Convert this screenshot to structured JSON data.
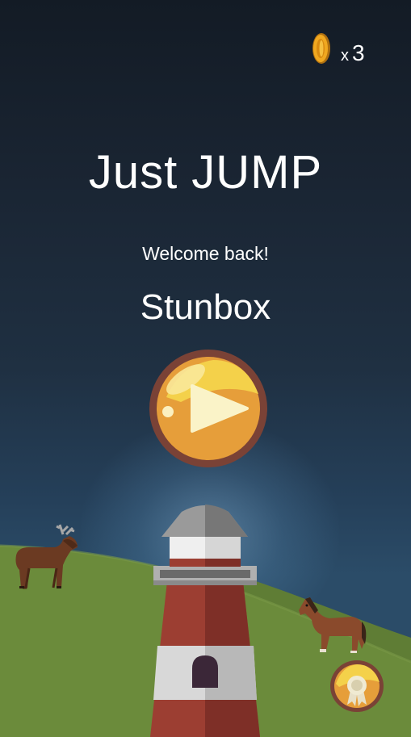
{
  "hud": {
    "coin_prefix": "x",
    "coin_count": "3",
    "coin_icon": "coin-icon"
  },
  "menu": {
    "title": "Just JUMP",
    "welcome": "Welcome back!",
    "username": "Stunbox",
    "play_icon": "play-icon",
    "achievements_icon": "award-ribbon-icon"
  },
  "colors": {
    "sky_top": "#131b25",
    "sky_bottom": "#2b4c68",
    "hill_green": "#6a8a3a",
    "button_gold": "#e8a030",
    "button_rim": "#7a4236",
    "lighthouse_red": "#9c3e32"
  }
}
